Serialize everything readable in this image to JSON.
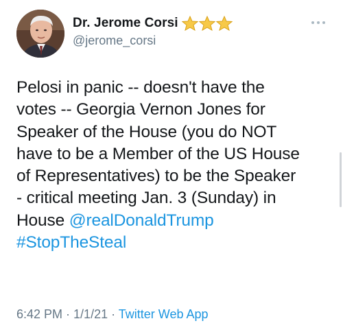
{
  "author": {
    "display_name": "Dr. Jerome Corsi",
    "handle": "@jerome_corsi",
    "name_emoji": [
      "star",
      "star",
      "star"
    ]
  },
  "tweet": {
    "lines": [
      "Pelosi in panic -- doesn't have the",
      "votes -- Georgia Vernon Jones for",
      "Speaker of the House (you do NOT",
      "have to be a Member of the US House",
      "of Representatives) to be the Speaker",
      "- critical meeting Jan. 3 (Sunday) in"
    ],
    "last_line_prefix": "House ",
    "mention": "@realDonaldTrump",
    "hashtag": "#StopTheSteal"
  },
  "meta": {
    "time": "6:42 PM",
    "separator1": " · ",
    "date": "1/1/21",
    "separator2": " · ",
    "source": "Twitter Web App"
  },
  "colors": {
    "link": "#1b95e0",
    "secondary_text": "#657786",
    "primary_text": "#14171a",
    "star": "#f7c948"
  },
  "icons": {
    "more": "more-horizontal-icon",
    "avatar": "profile-photo"
  }
}
